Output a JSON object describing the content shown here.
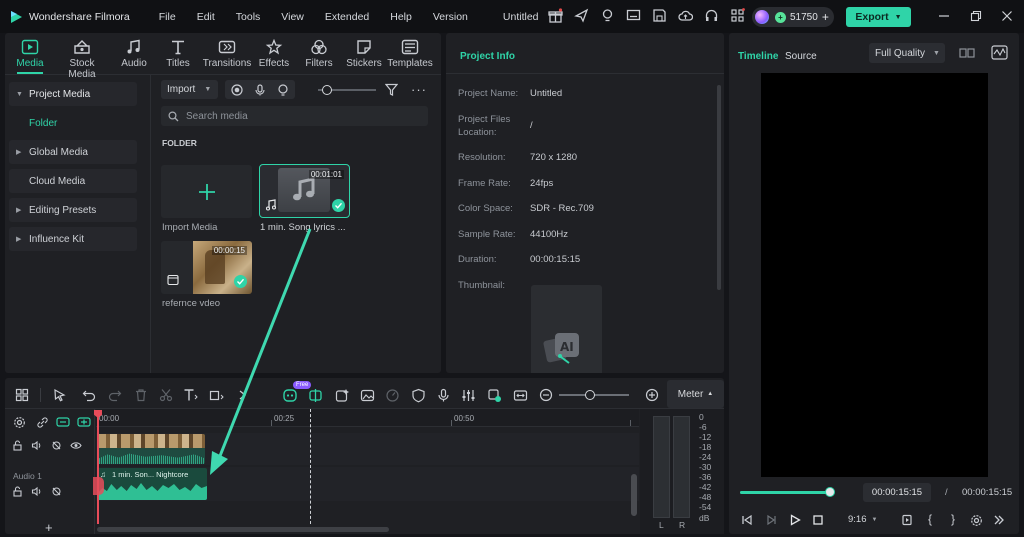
{
  "app": {
    "name": "Wondershare Filmora",
    "project_title": "Untitled"
  },
  "menu": [
    "File",
    "Edit",
    "Tools",
    "View",
    "Extended",
    "Help",
    "Version"
  ],
  "credits": "51750",
  "export_label": "Export",
  "toolbar": [
    {
      "label": "Media",
      "icon": "media-icon",
      "active": true
    },
    {
      "label": "Stock Media",
      "icon": "stock-media-icon"
    },
    {
      "label": "Audio",
      "icon": "music-note-icon"
    },
    {
      "label": "Titles",
      "icon": "titles-icon"
    },
    {
      "label": "Transitions",
      "icon": "transitions-icon"
    },
    {
      "label": "Effects",
      "icon": "effects-icon"
    },
    {
      "label": "Filters",
      "icon": "filters-icon"
    },
    {
      "label": "Stickers",
      "icon": "stickers-icon"
    },
    {
      "label": "Templates",
      "icon": "templates-icon"
    }
  ],
  "sidebar": {
    "project_media": "Project Media",
    "folder": "Folder",
    "global_media": "Global Media",
    "cloud_media": "Cloud Media",
    "editing_presets": "Editing Presets",
    "influence_kit": "Influence Kit"
  },
  "media": {
    "import_label": "Import",
    "search_placeholder": "Search media",
    "folder_heading": "FOLDER",
    "items": [
      {
        "name": "Import Media"
      },
      {
        "name": "1 min. Song lyrics ...",
        "duration": "00:01:01"
      },
      {
        "name": "refernce vdeo",
        "duration": "00:00:15"
      }
    ]
  },
  "project_info": {
    "title": "Project Info",
    "rows": [
      {
        "label": "Project Name:",
        "value": "Untitled"
      },
      {
        "label": "Project Files Location:",
        "value": "/"
      },
      {
        "label": "Resolution:",
        "value": "720 x 1280"
      },
      {
        "label": "Frame Rate:",
        "value": "24fps"
      },
      {
        "label": "Color Space:",
        "value": "SDR - Rec.709"
      },
      {
        "label": "Sample Rate:",
        "value": "44100Hz"
      },
      {
        "label": "Duration:",
        "value": "00:00:15:15"
      },
      {
        "label": "Thumbnail:",
        "value": ""
      }
    ]
  },
  "preview": {
    "tab_timeline": "Timeline",
    "tab_source": "Source",
    "quality": "Full Quality",
    "current_time": "00:00:15:15",
    "separator": "/",
    "total_time": "00:00:15:15",
    "aspect": "9:16",
    "progress": 1.0
  },
  "timeline": {
    "meter_label": "Meter",
    "new_badge": "Free",
    "ruler": [
      "00:00",
      "00:25",
      "00:50"
    ],
    "audio_track_label": "Audio 1",
    "audio_clip_label": "1 min. Son... Nightcore",
    "meter_scale": [
      "0",
      "-6",
      "-12",
      "-18",
      "-24",
      "-30",
      "-36",
      "-42",
      "-48",
      "-54",
      "dB"
    ],
    "meter_lr": [
      "L",
      "R"
    ]
  },
  "colors": {
    "accent": "#2fd4a8",
    "background": "#141519",
    "panel": "#1f2024"
  }
}
